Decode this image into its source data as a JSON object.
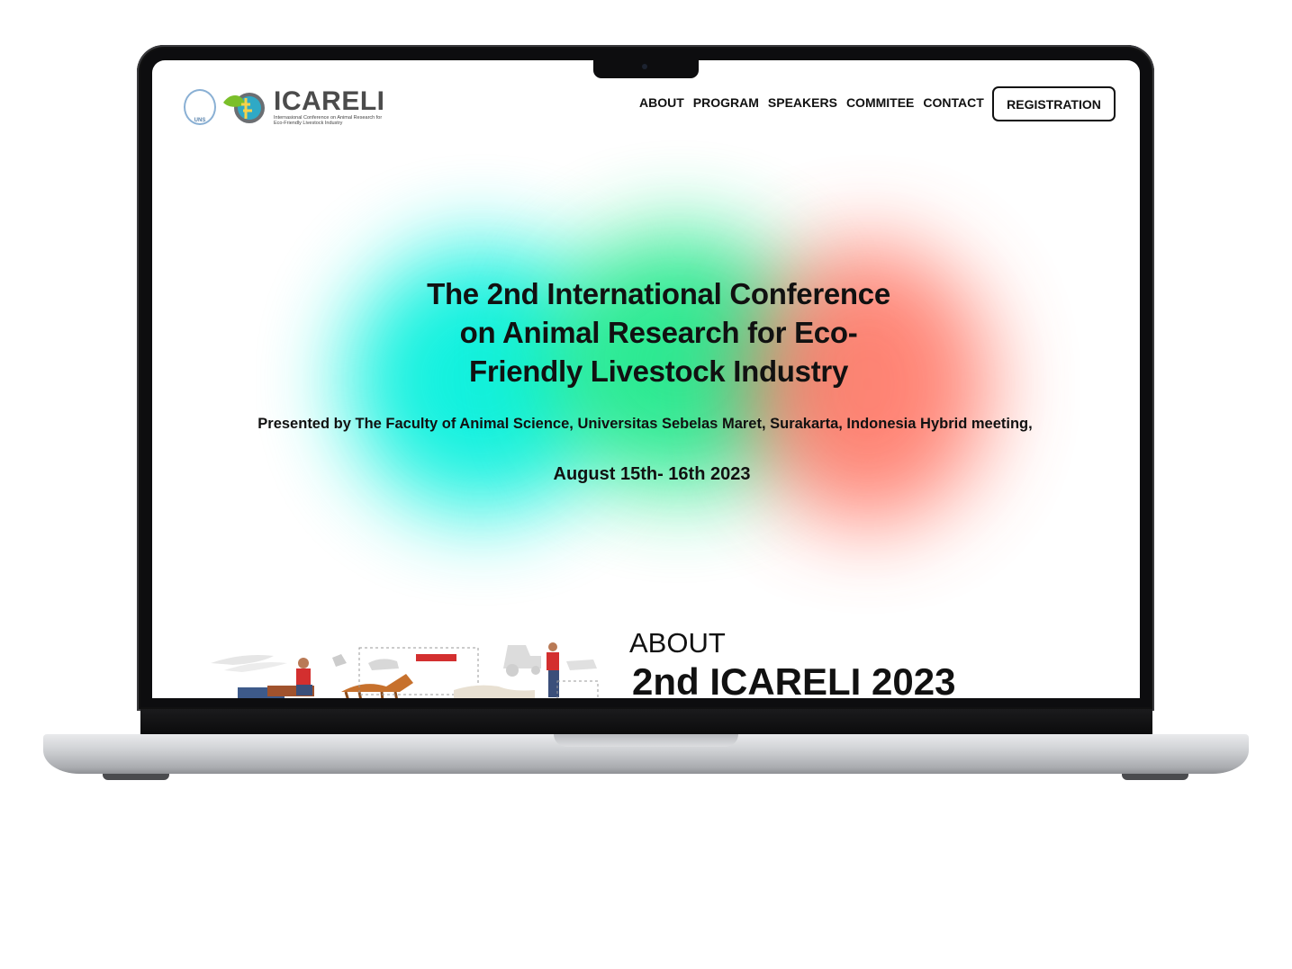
{
  "header": {
    "brand_name": "ICARELI",
    "brand_subtitle": "Internasional Conference on Animal Research for Eco-Friendly Livestock Industry",
    "uns_label": "UNS",
    "nav": [
      "ABOUT",
      "PROGRAM",
      "SPEAKERS",
      "COMMITEE",
      "CONTACT"
    ],
    "registration_label": "REGISTRATION"
  },
  "hero": {
    "title_lines": [
      "The 2nd International Conference",
      "on Animal Research for Eco-",
      "Friendly Livestock Industry"
    ],
    "subtitle": "Presented by The Faculty of Animal Science, Universitas Sebelas Maret, Surakarta, Indonesia Hybrid meeting,",
    "date": "August 15th- 16th 2023"
  },
  "about": {
    "label": "ABOUT",
    "title": "2nd ICARELI 2023"
  },
  "colors": {
    "blob_cyan": "#00f0dc",
    "blob_green": "#1ee889",
    "blob_red": "#ff6e5c",
    "text": "#111111"
  }
}
